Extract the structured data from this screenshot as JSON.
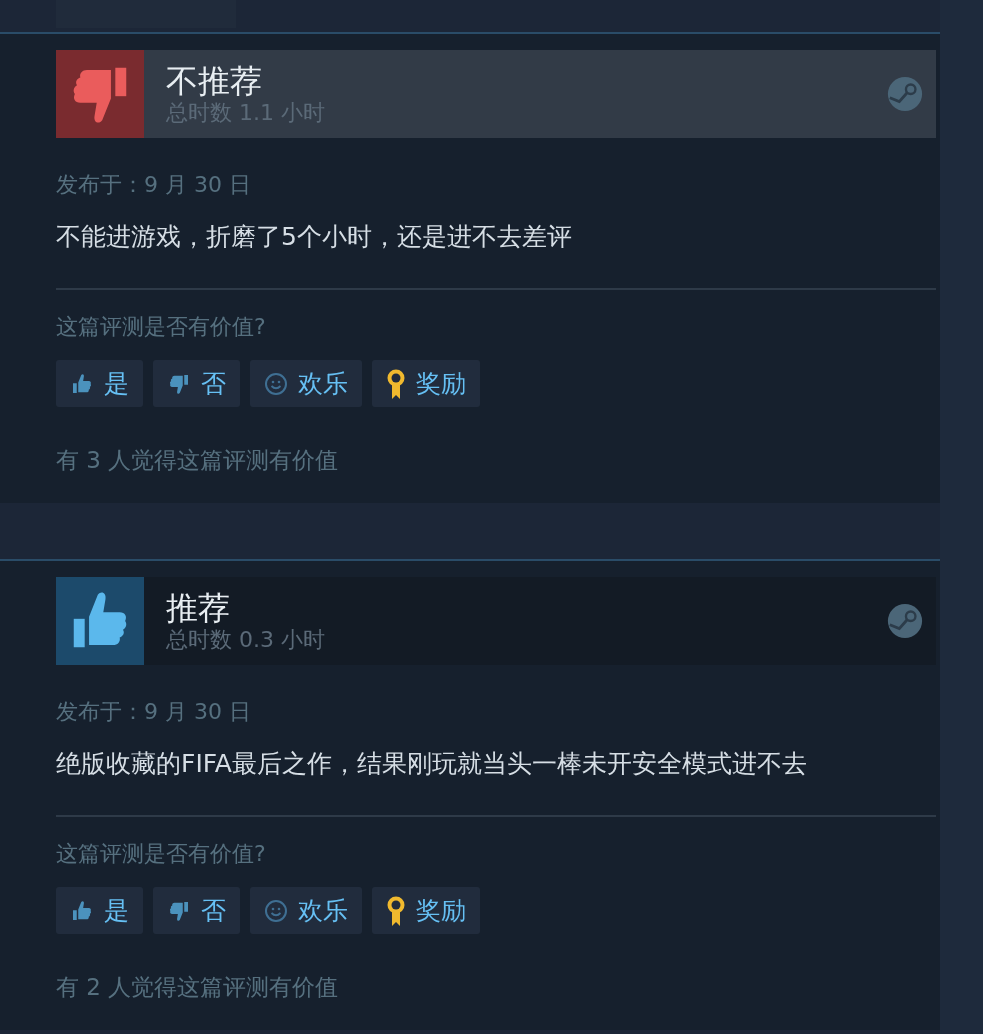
{
  "reviews": [
    {
      "recommended": false,
      "highlighted": true,
      "verdict": "不推荐",
      "playtime": "总时数 1.1 小时",
      "posted": "发布于：9 月 30 日",
      "text": "不能进游戏，折磨了5个小时，还是进不去差评",
      "question": "这篇评测是否有价值?",
      "buttons": [
        {
          "kind": "yes",
          "label": "是"
        },
        {
          "kind": "no",
          "label": "否"
        },
        {
          "kind": "funny",
          "label": "欢乐"
        },
        {
          "kind": "award",
          "label": "奖励"
        }
      ],
      "helpful": "有 3 人觉得这篇评测有价值"
    },
    {
      "recommended": true,
      "highlighted": false,
      "verdict": "推荐",
      "playtime": "总时数 0.3 小时",
      "posted": "发布于：9 月 30 日",
      "text": "绝版收藏的FIFA最后之作，结果刚玩就当头一棒未开安全模式进不去",
      "question": "这篇评测是否有价值?",
      "buttons": [
        {
          "kind": "yes",
          "label": "是"
        },
        {
          "kind": "no",
          "label": "否"
        },
        {
          "kind": "funny",
          "label": "欢乐"
        },
        {
          "kind": "award",
          "label": "奖励"
        }
      ],
      "helpful": "有 2 人觉得这篇评测有价值"
    }
  ]
}
